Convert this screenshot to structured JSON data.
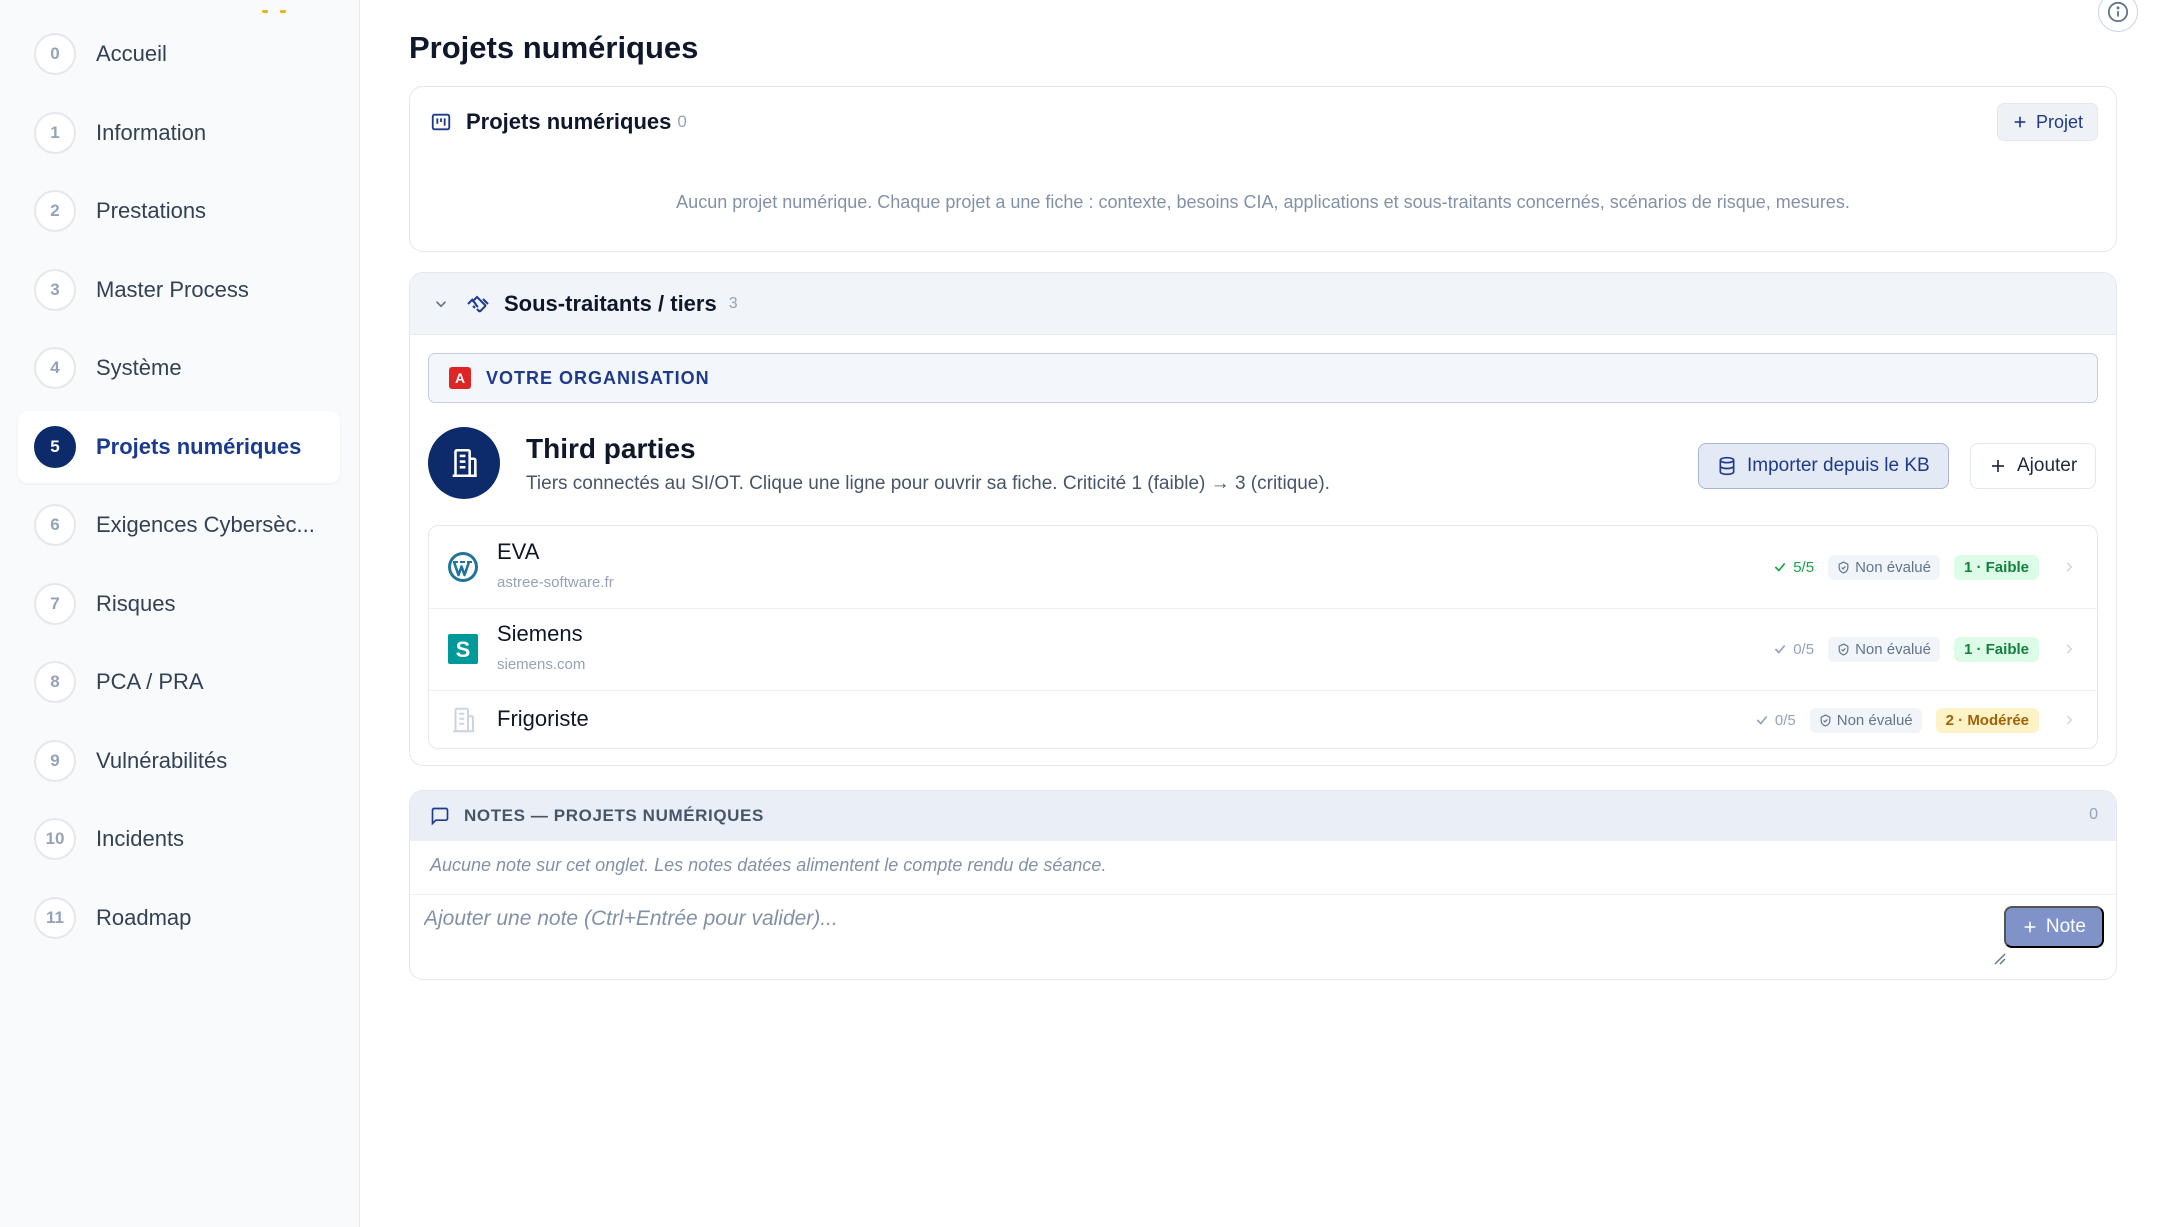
{
  "sidebar": {
    "items": [
      {
        "num": "0",
        "label": "Accueil"
      },
      {
        "num": "1",
        "label": "Information"
      },
      {
        "num": "2",
        "label": "Prestations"
      },
      {
        "num": "3",
        "label": "Master Process"
      },
      {
        "num": "4",
        "label": "Système"
      },
      {
        "num": "5",
        "label": "Projets numériques",
        "active": true
      },
      {
        "num": "6",
        "label": "Exigences Cybersèc..."
      },
      {
        "num": "7",
        "label": "Risques"
      },
      {
        "num": "8",
        "label": "PCA / PRA"
      },
      {
        "num": "9",
        "label": "Vulnérabilités"
      },
      {
        "num": "10",
        "label": "Incidents"
      },
      {
        "num": "11",
        "label": "Roadmap"
      }
    ]
  },
  "page": {
    "title": "Projets numériques"
  },
  "projets": {
    "title": "Projets numériques",
    "count": "0",
    "add_label": "Projet",
    "empty": "Aucun projet numérique. Chaque projet a une fiche : contexte, besoins CIA, applications et sous-traitants concernés, scénarios de risque, mesures."
  },
  "sous_traitants": {
    "title": "Sous-traitants / tiers",
    "count": "3",
    "org_badge": "A",
    "org_label": "VOTRE ORGANISATION",
    "section_title": "Third parties",
    "section_subtitle": "Tiers connectés au SI/OT. Clique une ligne pour ouvrir sa fiche. Criticité 1 (faible) → 3 (critique).",
    "import_label": "Importer depuis le KB",
    "add_label": "Ajouter",
    "rows": [
      {
        "name": "EVA",
        "domain": "astree-software.fr",
        "logo": "wordpress-icon",
        "check": "5/5",
        "status": "Non évalué",
        "criticity": "1 · Faible",
        "level": "low"
      },
      {
        "name": "Siemens",
        "domain": "siemens.com",
        "logo": "siemens-s-icon",
        "check": "0/5",
        "status": "Non évalué",
        "criticity": "1 · Faible",
        "level": "low"
      },
      {
        "name": "Frigoriste",
        "domain": "",
        "logo": "building-icon",
        "check": "0/5",
        "status": "Non évalué",
        "criticity": "2 · Modérée",
        "level": "mid"
      }
    ]
  },
  "notes": {
    "title": "NOTES — PROJETS NUMÉRIQUES",
    "count": "0",
    "empty": "Aucune note sur cet onglet. Les notes datées alimentent le compte rendu de séance.",
    "placeholder": "Ajouter une note (Ctrl+Entrée pour valider)...",
    "add_label": "Note"
  },
  "colors": {
    "accent": "#0d2a6b",
    "link": "#1b3b8f",
    "success": "#16a34a",
    "danger": "#dc2626",
    "warning_bg": "#fef3c7"
  }
}
